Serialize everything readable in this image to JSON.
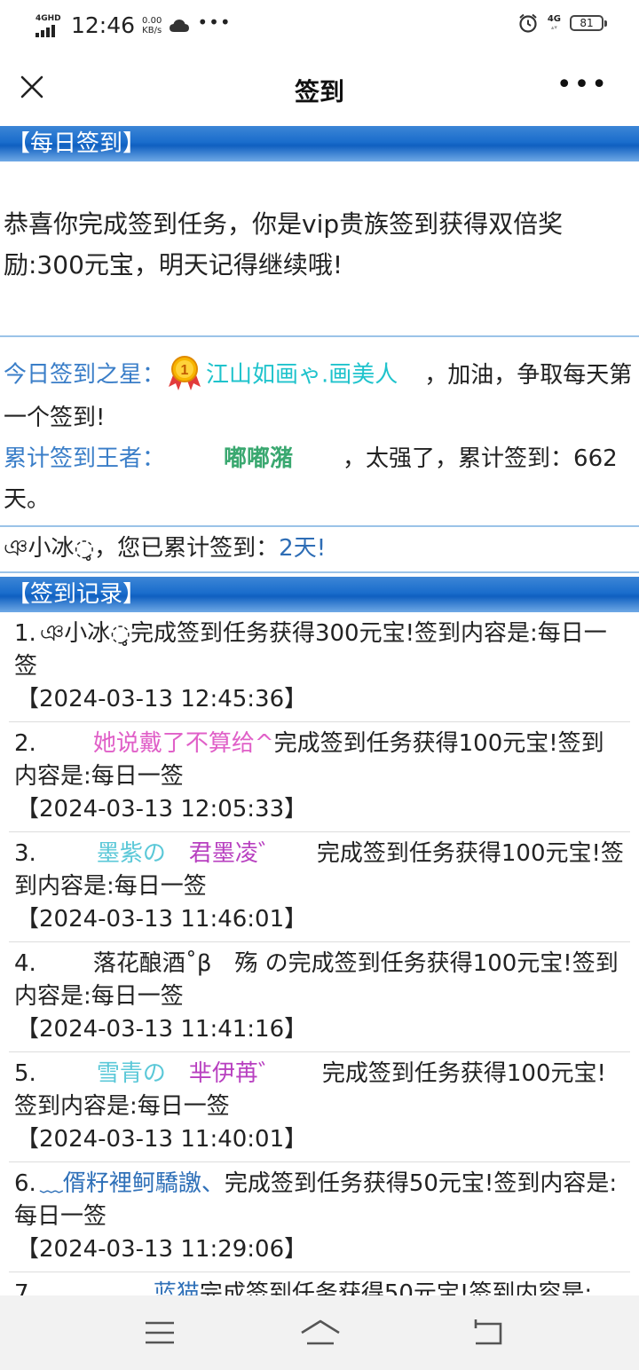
{
  "status_bar": {
    "network_label": "4GHD",
    "time": "12:46",
    "speed_value": "0.00",
    "speed_unit": "KB/s",
    "more": "•••",
    "net_right": "4G",
    "battery": "81"
  },
  "header": {
    "title": "签到",
    "more_label": "•••"
  },
  "daily_checkin": {
    "banner": "【每日签到】",
    "message": "恭喜你完成签到任务，你是vip贵族签到获得双倍奖励:300元宝，明天记得继续哦!"
  },
  "stars": {
    "today_label": "今日签到之星：",
    "today_name": "江山如画ゃ.画美人",
    "today_suffix": "，加油，争取每天第一个签到!",
    "king_label": "累计签到王者：",
    "king_name": "嘟嘟潴",
    "king_suffix": "，太强了，累计签到：662天。"
  },
  "mine": {
    "name": "ঞ小冰◌̥",
    "text": "，您已累计签到：",
    "days": "2天!"
  },
  "records_banner": "【签到记录】",
  "records": [
    {
      "num": "1.",
      "user": "ঞ小冰◌̥",
      "text": "完成签到任务获得300元宝!签到内容是:每日一签",
      "time": "【2024-03-13 12:45:36】"
    },
    {
      "num": "2.",
      "user": "她说戴了不算给^",
      "text": "完成签到任务获得100元宝!签到内容是:每日一签",
      "time": "【2024-03-13 12:05:33】"
    },
    {
      "num": "3.",
      "user_a": "墨紫の",
      "user_b": "君墨凌゛",
      "text": "完成签到任务获得100元宝!签到内容是:每日一签",
      "time": "【2024-03-13 11:46:01】"
    },
    {
      "num": "4.",
      "user": "落花酿酒˚β　殇 の",
      "text": "完成签到任务获得100元宝!签到内容是:每日一签",
      "time": "【2024-03-13 11:41:16】"
    },
    {
      "num": "5.",
      "user_a": "雪青の",
      "user_b": "芈伊苒゛",
      "text": "完成签到任务获得100元宝!签到内容是:每日一签",
      "time": "【2024-03-13 11:40:01】"
    },
    {
      "num": "6.",
      "user": "﹏偦籽裡鲄驕譤、",
      "text": "完成签到任务获得50元宝!签到内容是:每日一签",
      "time": "【2024-03-13 11:29:06】"
    },
    {
      "num": "7.",
      "user": "蓝猫",
      "text": "完成签到任务获得50元宝!签到内容是:"
    }
  ]
}
